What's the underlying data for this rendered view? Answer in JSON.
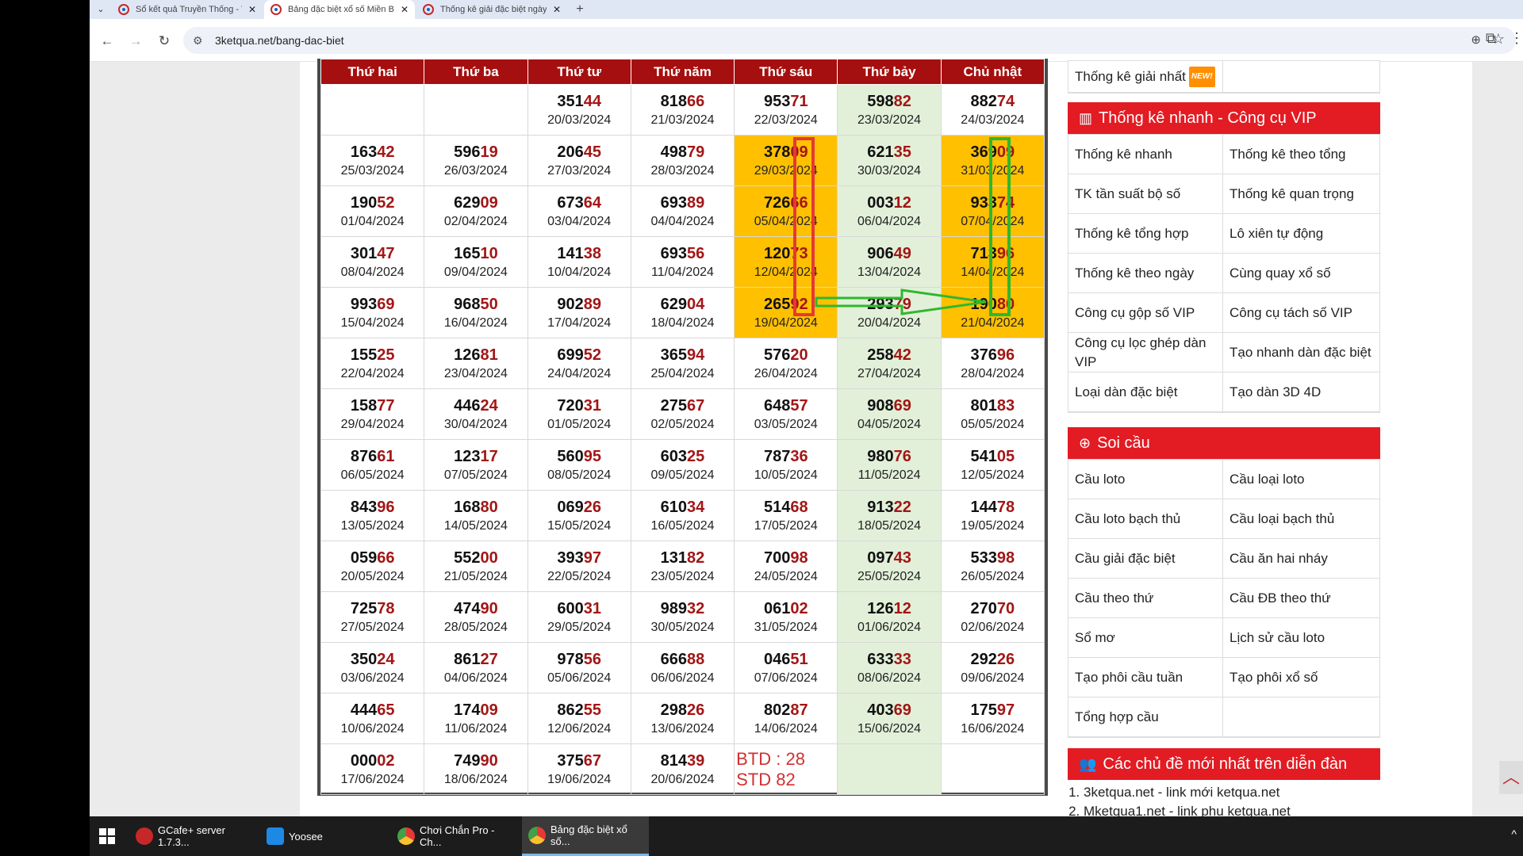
{
  "browser": {
    "tabs": [
      {
        "label": "Sổ kết quả Truyền Thống - Tổng",
        "active": false
      },
      {
        "label": "Bảng đặc biệt xổ số Miền Bắc t",
        "active": true
      },
      {
        "label": "Thống kê giải đặc biệt ngày hô",
        "active": false
      }
    ],
    "tab_close": "✕",
    "new_tab": "+",
    "url": "3ketqua.net/bang-dac-biet"
  },
  "table": {
    "headers": [
      "Thứ hai",
      "Thứ ba",
      "Thứ tư",
      "Thứ năm",
      "Thứ sáu",
      "Thứ bảy",
      "Chủ nhật"
    ],
    "rows": [
      [
        {
          "head": "",
          "tail": "",
          "date": ""
        },
        {
          "head": "",
          "tail": "",
          "date": ""
        },
        {
          "head": "351",
          "tail": "44",
          "date": "20/03/2024"
        },
        {
          "head": "818",
          "tail": "66",
          "date": "21/03/2024"
        },
        {
          "head": "953",
          "tail": "71",
          "date": "22/03/2024"
        },
        {
          "head": "598",
          "tail": "82",
          "date": "23/03/2024"
        },
        {
          "head": "882",
          "tail": "74",
          "date": "24/03/2024"
        }
      ],
      [
        {
          "head": "163",
          "tail": "42",
          "date": "25/03/2024"
        },
        {
          "head": "596",
          "tail": "19",
          "date": "26/03/2024"
        },
        {
          "head": "206",
          "tail": "45",
          "date": "27/03/2024"
        },
        {
          "head": "498",
          "tail": "79",
          "date": "28/03/2024"
        },
        {
          "head": "378",
          "tail": "09",
          "date": "29/03/2024",
          "hl": true
        },
        {
          "head": "621",
          "tail": "35",
          "date": "30/03/2024"
        },
        {
          "head": "369",
          "tail": "09",
          "date": "31/03/2024",
          "hl": true
        }
      ],
      [
        {
          "head": "190",
          "tail": "52",
          "date": "01/04/2024"
        },
        {
          "head": "629",
          "tail": "09",
          "date": "02/04/2024"
        },
        {
          "head": "673",
          "tail": "64",
          "date": "03/04/2024"
        },
        {
          "head": "693",
          "tail": "89",
          "date": "04/04/2024"
        },
        {
          "head": "726",
          "tail": "66",
          "date": "05/04/2024",
          "hl": true
        },
        {
          "head": "003",
          "tail": "12",
          "date": "06/04/2024"
        },
        {
          "head": "933",
          "tail": "74",
          "date": "07/04/2024",
          "hl": true
        }
      ],
      [
        {
          "head": "301",
          "tail": "47",
          "date": "08/04/2024"
        },
        {
          "head": "165",
          "tail": "10",
          "date": "09/04/2024"
        },
        {
          "head": "141",
          "tail": "38",
          "date": "10/04/2024"
        },
        {
          "head": "693",
          "tail": "56",
          "date": "11/04/2024"
        },
        {
          "head": "120",
          "tail": "73",
          "date": "12/04/2024",
          "hl": true
        },
        {
          "head": "906",
          "tail": "49",
          "date": "13/04/2024"
        },
        {
          "head": "713",
          "tail": "96",
          "date": "14/04/2024",
          "hl": true
        }
      ],
      [
        {
          "head": "993",
          "tail": "69",
          "date": "15/04/2024"
        },
        {
          "head": "968",
          "tail": "50",
          "date": "16/04/2024"
        },
        {
          "head": "902",
          "tail": "89",
          "date": "17/04/2024"
        },
        {
          "head": "629",
          "tail": "04",
          "date": "18/04/2024"
        },
        {
          "head": "265",
          "tail": "92",
          "date": "19/04/2024",
          "hl": true
        },
        {
          "head": "293",
          "tail": "79",
          "date": "20/04/2024"
        },
        {
          "head": "190",
          "tail": "80",
          "date": "21/04/2024",
          "hl": true
        }
      ],
      [
        {
          "head": "155",
          "tail": "25",
          "date": "22/04/2024"
        },
        {
          "head": "126",
          "tail": "81",
          "date": "23/04/2024"
        },
        {
          "head": "699",
          "tail": "52",
          "date": "24/04/2024"
        },
        {
          "head": "365",
          "tail": "94",
          "date": "25/04/2024"
        },
        {
          "head": "576",
          "tail": "20",
          "date": "26/04/2024"
        },
        {
          "head": "258",
          "tail": "42",
          "date": "27/04/2024"
        },
        {
          "head": "376",
          "tail": "96",
          "date": "28/04/2024"
        }
      ],
      [
        {
          "head": "158",
          "tail": "77",
          "date": "29/04/2024"
        },
        {
          "head": "446",
          "tail": "24",
          "date": "30/04/2024"
        },
        {
          "head": "720",
          "tail": "31",
          "date": "01/05/2024"
        },
        {
          "head": "275",
          "tail": "67",
          "date": "02/05/2024"
        },
        {
          "head": "648",
          "tail": "57",
          "date": "03/05/2024"
        },
        {
          "head": "908",
          "tail": "69",
          "date": "04/05/2024"
        },
        {
          "head": "801",
          "tail": "83",
          "date": "05/05/2024"
        }
      ],
      [
        {
          "head": "876",
          "tail": "61",
          "date": "06/05/2024"
        },
        {
          "head": "123",
          "tail": "17",
          "date": "07/05/2024"
        },
        {
          "head": "560",
          "tail": "95",
          "date": "08/05/2024"
        },
        {
          "head": "603",
          "tail": "25",
          "date": "09/05/2024"
        },
        {
          "head": "787",
          "tail": "36",
          "date": "10/05/2024"
        },
        {
          "head": "980",
          "tail": "76",
          "date": "11/05/2024"
        },
        {
          "head": "541",
          "tail": "05",
          "date": "12/05/2024"
        }
      ],
      [
        {
          "head": "843",
          "tail": "96",
          "date": "13/05/2024"
        },
        {
          "head": "168",
          "tail": "80",
          "date": "14/05/2024"
        },
        {
          "head": "069",
          "tail": "26",
          "date": "15/05/2024"
        },
        {
          "head": "610",
          "tail": "34",
          "date": "16/05/2024"
        },
        {
          "head": "514",
          "tail": "68",
          "date": "17/05/2024"
        },
        {
          "head": "913",
          "tail": "22",
          "date": "18/05/2024"
        },
        {
          "head": "144",
          "tail": "78",
          "date": "19/05/2024"
        }
      ],
      [
        {
          "head": "059",
          "tail": "66",
          "date": "20/05/2024"
        },
        {
          "head": "552",
          "tail": "00",
          "date": "21/05/2024"
        },
        {
          "head": "393",
          "tail": "97",
          "date": "22/05/2024"
        },
        {
          "head": "131",
          "tail": "82",
          "date": "23/05/2024"
        },
        {
          "head": "700",
          "tail": "98",
          "date": "24/05/2024"
        },
        {
          "head": "097",
          "tail": "43",
          "date": "25/05/2024"
        },
        {
          "head": "533",
          "tail": "98",
          "date": "26/05/2024"
        }
      ],
      [
        {
          "head": "725",
          "tail": "78",
          "date": "27/05/2024"
        },
        {
          "head": "474",
          "tail": "90",
          "date": "28/05/2024"
        },
        {
          "head": "600",
          "tail": "31",
          "date": "29/05/2024"
        },
        {
          "head": "989",
          "tail": "32",
          "date": "30/05/2024"
        },
        {
          "head": "061",
          "tail": "02",
          "date": "31/05/2024"
        },
        {
          "head": "126",
          "tail": "12",
          "date": "01/06/2024"
        },
        {
          "head": "270",
          "tail": "70",
          "date": "02/06/2024"
        }
      ],
      [
        {
          "head": "350",
          "tail": "24",
          "date": "03/06/2024"
        },
        {
          "head": "861",
          "tail": "27",
          "date": "04/06/2024"
        },
        {
          "head": "978",
          "tail": "56",
          "date": "05/06/2024"
        },
        {
          "head": "666",
          "tail": "88",
          "date": "06/06/2024"
        },
        {
          "head": "046",
          "tail": "51",
          "date": "07/06/2024"
        },
        {
          "head": "633",
          "tail": "33",
          "date": "08/06/2024"
        },
        {
          "head": "292",
          "tail": "26",
          "date": "09/06/2024"
        }
      ],
      [
        {
          "head": "444",
          "tail": "65",
          "date": "10/06/2024"
        },
        {
          "head": "174",
          "tail": "09",
          "date": "11/06/2024"
        },
        {
          "head": "862",
          "tail": "55",
          "date": "12/06/2024"
        },
        {
          "head": "298",
          "tail": "26",
          "date": "13/06/2024"
        },
        {
          "head": "802",
          "tail": "87",
          "date": "14/06/2024"
        },
        {
          "head": "403",
          "tail": "69",
          "date": "15/06/2024"
        },
        {
          "head": "175",
          "tail": "97",
          "date": "16/06/2024"
        }
      ],
      [
        {
          "head": "000",
          "tail": "02",
          "date": "17/06/2024"
        },
        {
          "head": "749",
          "tail": "90",
          "date": "18/06/2024"
        },
        {
          "head": "375",
          "tail": "67",
          "date": "19/06/2024"
        },
        {
          "head": "814",
          "tail": "39",
          "date": "20/06/2024"
        },
        {
          "head": "",
          "tail": "",
          "date": "",
          "note": "BTD : 28 STD 82"
        },
        {
          "head": "",
          "tail": "",
          "date": ""
        },
        {
          "head": "",
          "tail": "",
          "date": ""
        }
      ]
    ]
  },
  "sidebar": {
    "top_item": "Thống kê giải nhất",
    "top_badge": "NEW!",
    "vip": {
      "title": "Thống kê nhanh - Công cụ VIP",
      "items": [
        "Thống kê nhanh",
        "Thống kê theo tổng",
        "TK tần suất bộ số",
        "Thống kê quan trọng",
        "Thống kê tổng hợp",
        "Lô xiên tự động",
        "Thống kê theo ngày",
        "Cùng quay xổ số",
        "Công cụ gộp số VIP",
        "Công cụ tách số VIP",
        "Công cụ lọc ghép dàn VIP",
        "Tạo nhanh dàn đặc biệt",
        "Loại dàn đặc biệt",
        "Tạo dàn 3D 4D"
      ]
    },
    "soicau": {
      "title": "Soi cầu",
      "items": [
        "Cầu loto",
        "Cầu loại loto",
        "Cầu loto bạch thủ",
        "Cầu loại bạch thủ",
        "Cầu giải đặc biệt",
        "Cầu ăn hai nháy",
        "Cầu theo thứ",
        "Cầu ĐB theo thứ",
        "Sổ mơ",
        "Lịch sử cầu loto",
        "Tạo phôi cầu tuần",
        "Tạo phôi xổ số",
        "Tổng hợp cầu",
        ""
      ]
    },
    "forum": {
      "title": "Các chủ đề mới nhất trên diễn đàn",
      "items": [
        "3ketqua.net - link mới ketqua.net",
        "Mketqua1.net - link phụ ketqua.net"
      ]
    }
  },
  "taskbar": {
    "items": [
      {
        "label": "GCafe+ server 1.7.3...",
        "color": "#c62828"
      },
      {
        "label": "Yoosee",
        "color": "#1e88e5"
      },
      {
        "label": "Chơi Chắn Pro - Ch...",
        "color": "#4caf50"
      },
      {
        "label": "Bảng đặc biệt xổ số...",
        "color": "#4caf50"
      }
    ]
  },
  "colors": {
    "header_red": "#a60f0f",
    "tail_red": "#a31616",
    "highlight_orange": "#ffc000",
    "saturday_green": "#e2f0d9",
    "sidebar_red": "#e31b23",
    "annotation_red": "#e53935",
    "annotation_green": "#2eb82e"
  }
}
